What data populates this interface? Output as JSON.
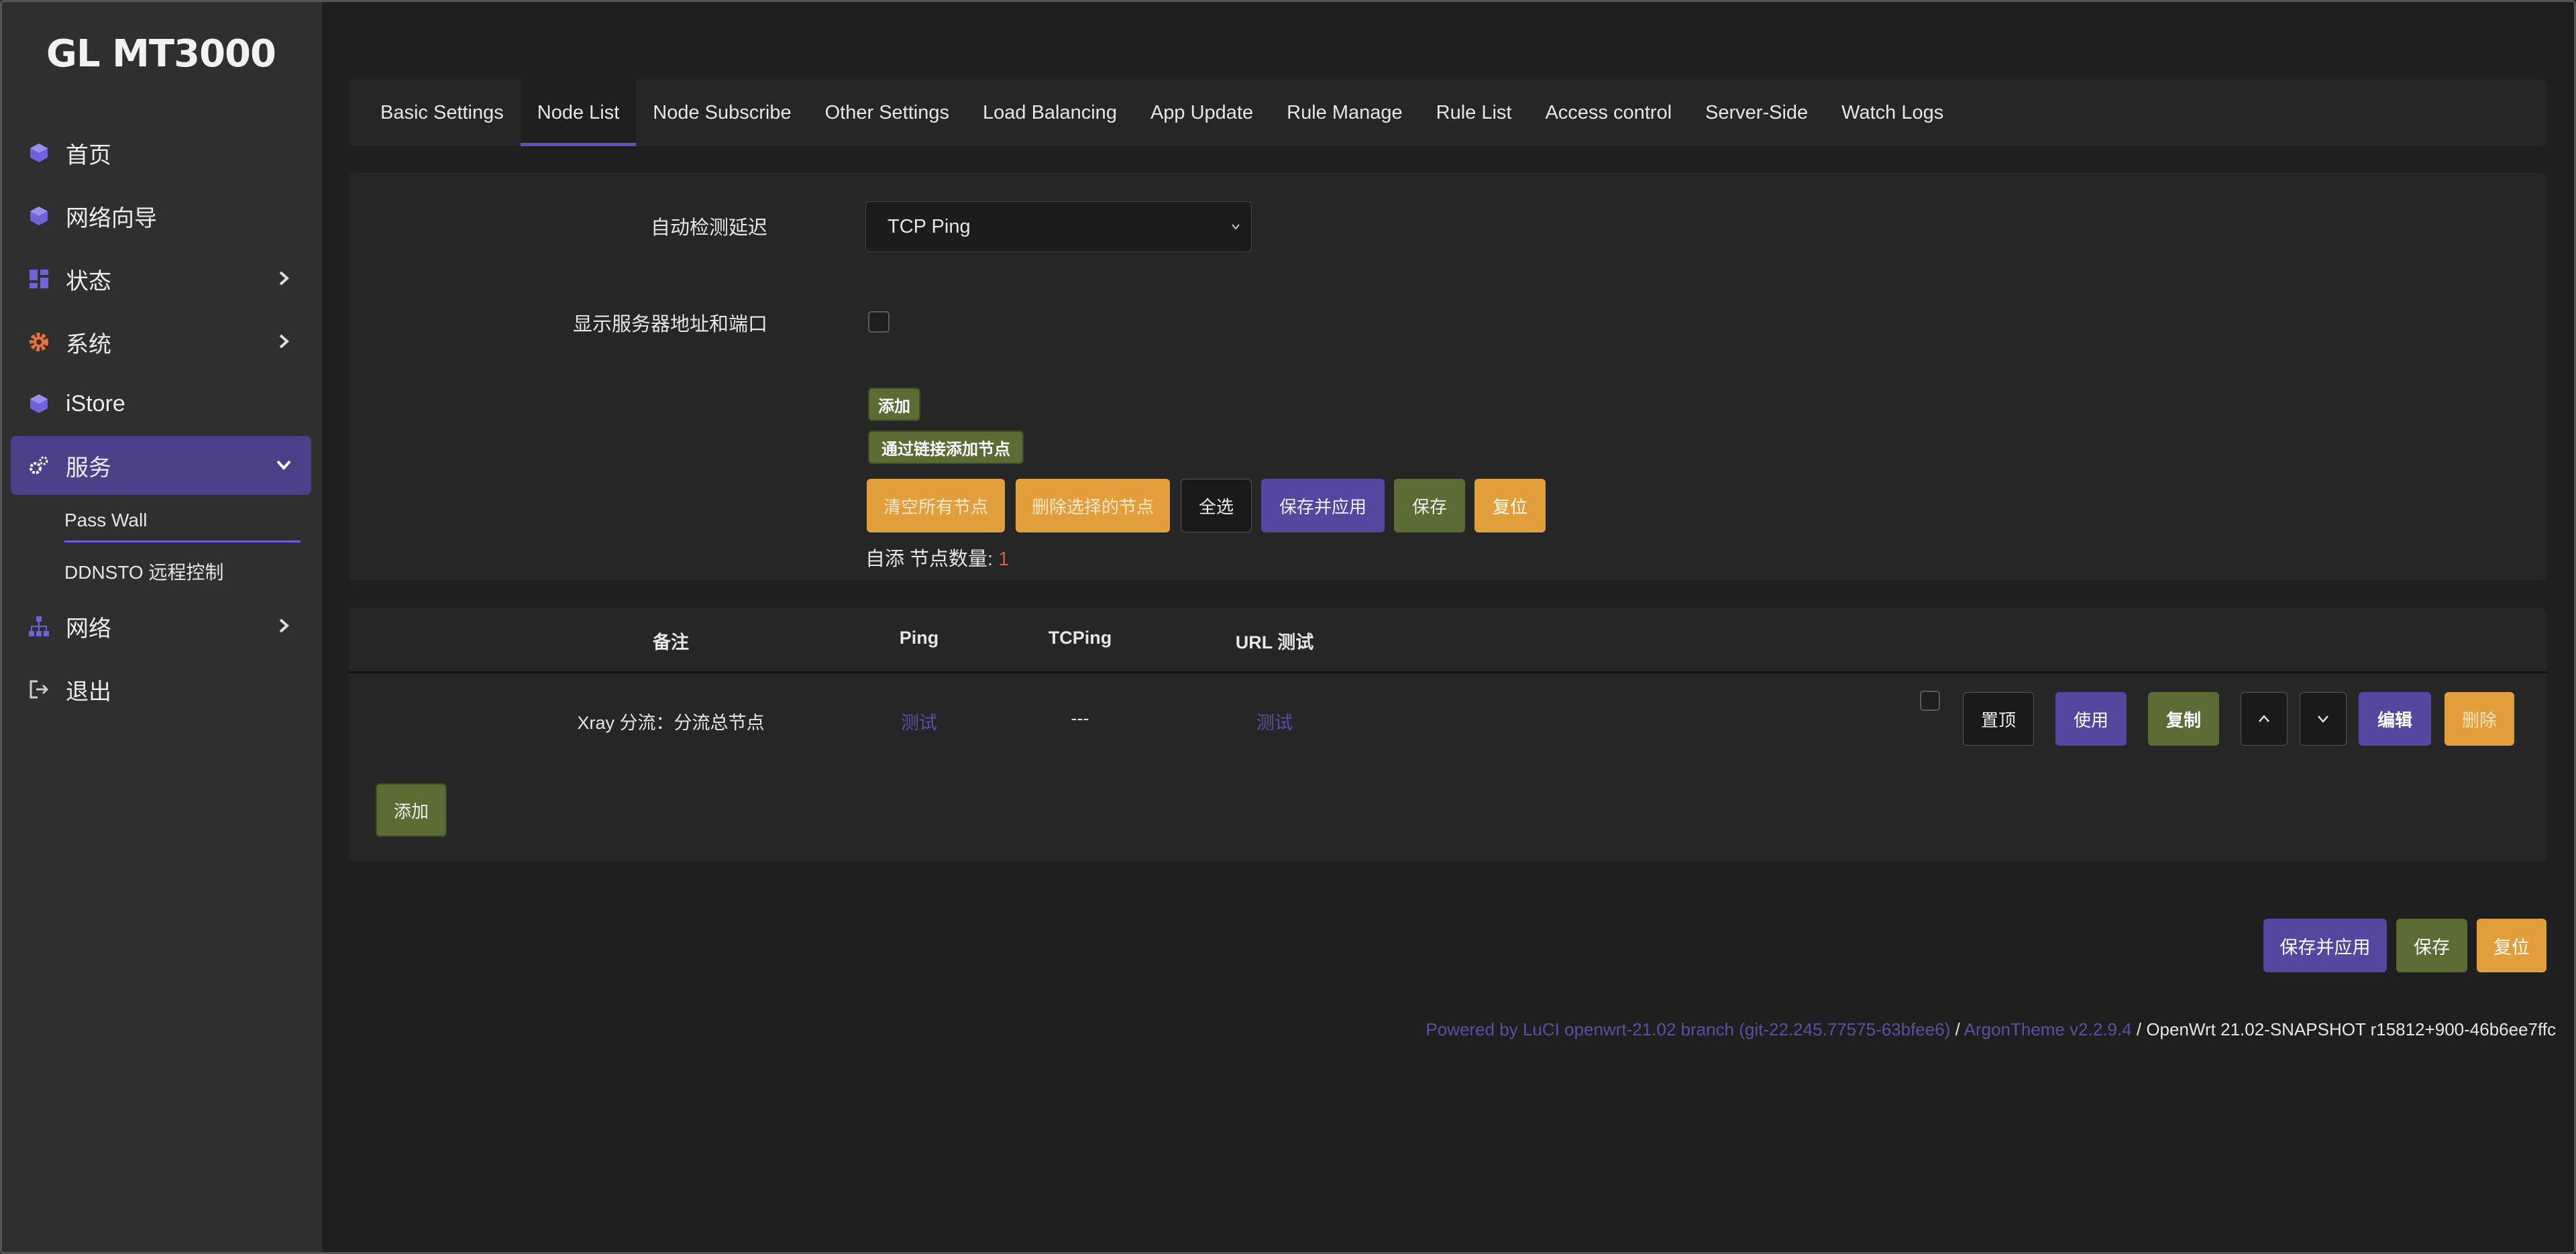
{
  "brand": "GL MT3000",
  "sidebar": {
    "items": [
      {
        "label": "首页",
        "icon": "cube-icon"
      },
      {
        "label": "网络向导",
        "icon": "cube-icon"
      },
      {
        "label": "状态",
        "icon": "dashboard-icon"
      },
      {
        "label": "系统",
        "icon": "gear-icon"
      },
      {
        "label": "iStore",
        "icon": "cube-icon"
      },
      {
        "label": "服务",
        "icon": "gears-icon"
      },
      {
        "label": "网络",
        "icon": "sitemap-icon"
      },
      {
        "label": "退出",
        "icon": "logout-icon"
      }
    ],
    "sub_items": [
      "Pass Wall",
      "DDNSTO 远程控制"
    ]
  },
  "tabs": [
    "Basic Settings",
    "Node List",
    "Node Subscribe",
    "Other Settings",
    "Load Balancing",
    "App Update",
    "Rule Manage",
    "Rule List",
    "Access control",
    "Server-Side",
    "Watch Logs"
  ],
  "settings": {
    "auto_detect_label": "自动检测延迟",
    "auto_detect_value": "TCP Ping",
    "show_addr_label": "显示服务器地址和端口",
    "add_label": "添加",
    "add_link_label": "通过链接添加节点",
    "clear_all_label": "清空所有节点",
    "delete_selected_label": "删除选择的节点",
    "select_all_label": "全选",
    "save_apply_label": "保存并应用",
    "save_label": "保存",
    "reset_label": "复位",
    "count_prefix": "自添 节点数量: ",
    "count_value": "1"
  },
  "table": {
    "headers": [
      "备注",
      "Ping",
      "TCPing",
      "URL 测试"
    ],
    "rows": [
      {
        "remark": "Xray 分流：分流总节点",
        "ping": "测试",
        "tcping": "---",
        "url": "测试"
      }
    ],
    "row_actions": {
      "top": "置顶",
      "use": "使用",
      "copy": "复制",
      "edit": "编辑",
      "delete": "删除"
    },
    "add_label": "添加"
  },
  "footer": {
    "save_apply": "保存并应用",
    "save": "保存",
    "reset": "复位",
    "powered_luci": "Powered by LuCI openwrt-21.02 branch (git-22.245.77575-63bfee6)",
    "sep1": " / ",
    "argon": "ArgonTheme v2.2.9.4",
    "sep2": " / ",
    "openwrt": "OpenWrt 21.02-SNAPSHOT r15812+900-46b6ee7ffc"
  },
  "colors": {
    "accent": "#5547a0",
    "green": "#5a6b34",
    "orange": "#e29e3a",
    "sidebar_active": "#4b3f88"
  }
}
